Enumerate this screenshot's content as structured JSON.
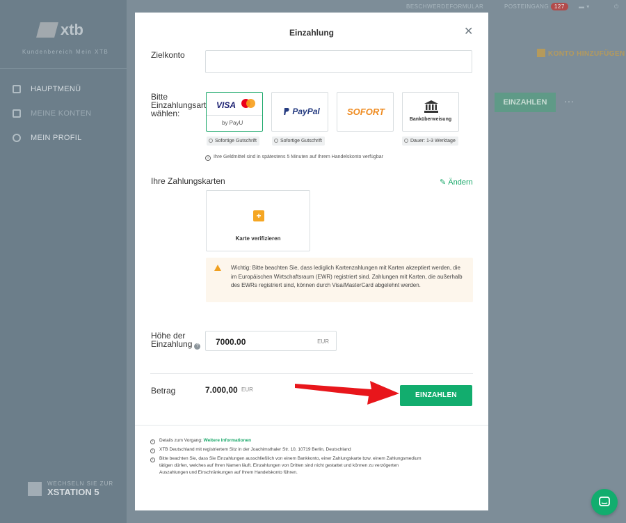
{
  "background": {
    "logo": "xtb",
    "sidebar_subtitle": "Kundenbereich Mein XTB",
    "menu": [
      {
        "label": "HAUPTMENÜ",
        "icon": "home-icon"
      },
      {
        "label": "MEINE KONTEN",
        "icon": "accounts-icon"
      },
      {
        "label": "MEIN PROFIL",
        "icon": "user-icon"
      }
    ],
    "xstation_small": "WECHSELN SIE ZUR",
    "xstation_big": "XSTATION 5",
    "top_complaint": "BESCHWERDEFORMULAR",
    "top_inbox": "POSTEINGANG",
    "top_inbox_count": "127",
    "konto_add": "KONTO HINZUFÜGEN",
    "einzahlen_bg": "EINZAHLEN",
    "dots": "···"
  },
  "modal": {
    "title": "Einzahlung",
    "close": "✕",
    "zielkonto_label": "Zielkonto",
    "zielkonto_value": "",
    "method_label_1": "Bitte",
    "method_label_2": "Einzahlungsart",
    "method_label_3": "wählen:",
    "methods": [
      {
        "name": "VISA",
        "name2": "by PayU",
        "tag": "Sofortige Gutschrift",
        "selected": true
      },
      {
        "name": "PayPal",
        "tag": "Sofortige Gutschrift"
      },
      {
        "name": "SOFORT",
        "tag": ""
      },
      {
        "name": "Banküberweisung",
        "tag": "Dauer: 1-3 Werktage"
      }
    ],
    "funds_info": "Ihre Geldmittel sind in spätestens 5 Minuten auf Ihrem Handelskonto verfügbar",
    "cards_title": "Ihre Zahlungskarten",
    "aendern": "Ändern",
    "card_verify": "Karte verifizieren",
    "warning": "Wichtig: Bitte beachten Sie, dass lediglich Kartenzahlungen mit Karten akzeptiert werden, die im Europäischen Wirtschaftsraum (EWR) registriert sind. Zahlungen mit Karten, die außerhalb des EWRs registriert sind, können durch Visa/MasterCard abgelehnt werden.",
    "amount_label_1": "Höhe der",
    "amount_label_2": "Einzahlung",
    "amount_value": "7000.00",
    "amount_currency": "EUR",
    "betrag_label": "Betrag",
    "betrag_value": "7.000,00",
    "betrag_currency": "EUR",
    "submit": "EINZAHLEN",
    "footer_1_prefix": "Details zum Vorgang:",
    "footer_1_link": "Weitere Informationen",
    "footer_2": "XTB Deutschland mit registriertem Sitz in der Joachimsthaler Str. 10, 10719 Berlin, Deutschland",
    "footer_3a": "Bitte beachten Sie, dass Sie Einzahlungen ausschließlich von einem Bankkonto, einer Zahlungskarte bzw. einem Zahlungsmedium",
    "footer_3b": "tätigen dürfen, welches auf Ihren Namen läuft. Einzahlungen von Dritten sind nicht gestattet und können zu verzögerten",
    "footer_3c": "Auszahlungen und Einschränkungen auf Ihrem Handelskonto führen."
  },
  "colors": {
    "accent": "#12ad6e",
    "warning": "#f0a020",
    "arrow": "#e8161b"
  }
}
